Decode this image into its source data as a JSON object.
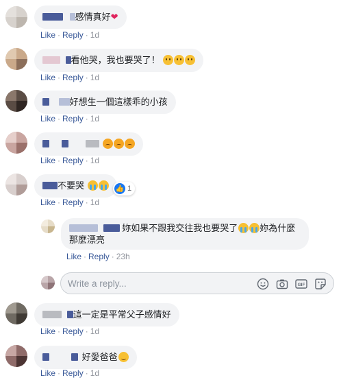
{
  "actions": {
    "like": "Like",
    "reply": "Reply",
    "separator": "·"
  },
  "comments": [
    {
      "text": "感情真好",
      "time": "1d"
    },
    {
      "text": "看他哭，我也要哭了！",
      "time": "1d"
    },
    {
      "text": "好想生一個這樣乖的小孩",
      "time": "1d"
    },
    {
      "text": "",
      "time": "1d"
    },
    {
      "text": "不要哭",
      "time": "1d",
      "reaction_count": "1"
    },
    {
      "text": "妳如果不跟我交往我也要哭了",
      "text2": "妳為什麼",
      "text3": "那麼漂亮",
      "time": "23h"
    },
    {
      "text": "這一定是平常父子感情好",
      "time": "1d"
    },
    {
      "text": "好愛爸爸",
      "time": "1d"
    }
  ],
  "reply_box": {
    "placeholder": "Write a reply..."
  },
  "colors": {
    "link": "#385898",
    "bubble": "#f2f3f5",
    "like_blue": "#1877f2"
  }
}
